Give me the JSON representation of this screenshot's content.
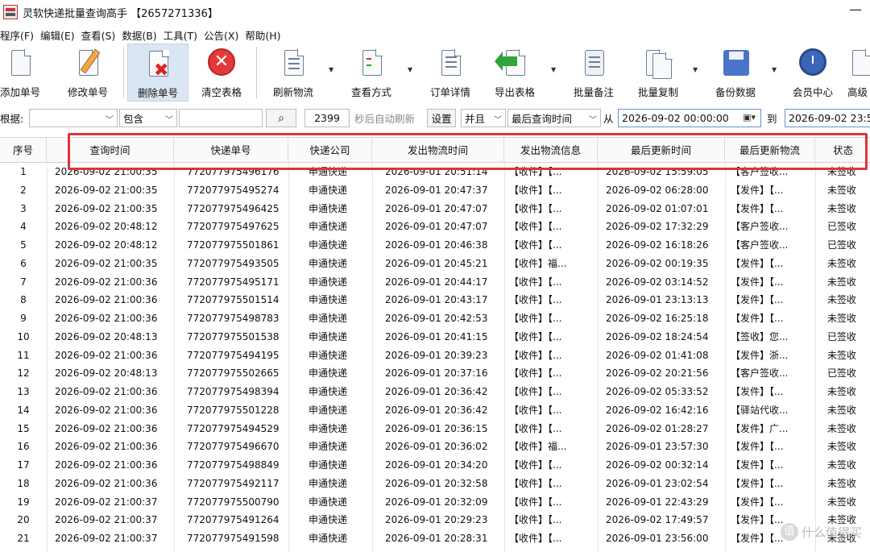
{
  "window": {
    "title": "灵软快递批量查询高手 【2657271336】",
    "minimize": "—"
  },
  "menu": [
    "程序(F)",
    "编辑(E)",
    "查看(S)",
    "数据(B)",
    "工具(T)",
    "公告(X)",
    "帮助(H)"
  ],
  "toolbar": [
    {
      "label": "添加单号",
      "icon": "add-doc-icon"
    },
    {
      "label": "修改单号",
      "icon": "edit-pencil-icon"
    },
    {
      "label": "删除单号",
      "icon": "delete-x-icon"
    },
    {
      "label": "清空表格",
      "icon": "clear-stop-icon"
    },
    {
      "label": "刷新物流",
      "icon": "refresh-doc-icon"
    },
    {
      "label": "查看方式",
      "icon": "view-list-icon"
    },
    {
      "label": "订单详情",
      "icon": "order-detail-icon"
    },
    {
      "label": "导出表格",
      "icon": "export-arrow-icon"
    },
    {
      "label": "批量备注",
      "icon": "batch-note-icon"
    },
    {
      "label": "批量复制",
      "icon": "batch-copy-icon"
    },
    {
      "label": "备份数据",
      "icon": "floppy-icon"
    },
    {
      "label": "会员中心",
      "icon": "clock-member-icon"
    },
    {
      "label": "高级",
      "icon": "advanced-icon"
    }
  ],
  "filter": {
    "by_label": "根据:",
    "field_value": "",
    "match_value": "包含",
    "keyword_value": "",
    "search_glyph": "⌕",
    "refresh_seconds": "2399",
    "refresh_suffix": "秒后自动刷新",
    "settings_label": "设置",
    "logic_value": "并且",
    "time_field_value": "最后查询时间",
    "from_label": "从",
    "from_value": "2026-09-02 00:00:00",
    "to_label": "到",
    "to_value": "2026-09-02 23:5"
  },
  "table": {
    "columns": [
      "序号",
      "查询时间",
      "快递单号",
      "快递公司",
      "发出物流时间",
      "发出物流信息",
      "最后更新时间",
      "最后更新物流",
      "状态"
    ],
    "rows": [
      [
        "1",
        "2026-09-02 21:00:35",
        "772077975496176",
        "申通快递",
        "2026-09-01 20:51:14",
        "【收件】【...",
        "2026-09-02 15:59:05",
        "【客户签收...",
        "未签收"
      ],
      [
        "2",
        "2026-09-02 21:00:35",
        "772077975495274",
        "申通快递",
        "2026-09-01 20:47:37",
        "【收件】【...",
        "2026-09-02 06:28:00",
        "【发件】【...",
        "未签收"
      ],
      [
        "3",
        "2026-09-02 21:00:35",
        "772077975496425",
        "申通快递",
        "2026-09-01 20:47:07",
        "【收件】【...",
        "2026-09-02 01:07:01",
        "【发件】【...",
        "未签收"
      ],
      [
        "4",
        "2026-09-02 20:48:12",
        "772077975497625",
        "申通快递",
        "2026-09-01 20:47:07",
        "【收件】【...",
        "2026-09-02 17:32:29",
        "【客户签收...",
        "已签收"
      ],
      [
        "5",
        "2026-09-02 20:48:12",
        "772077975501861",
        "申通快递",
        "2026-09-01 20:46:38",
        "【收件】【...",
        "2026-09-02 16:18:26",
        "【客户签收...",
        "已签收"
      ],
      [
        "6",
        "2026-09-02 21:00:35",
        "772077975493505",
        "申通快递",
        "2026-09-01 20:45:21",
        "【收件】福...",
        "2026-09-02 00:19:35",
        "【发件】【...",
        "未签收"
      ],
      [
        "7",
        "2026-09-02 21:00:36",
        "772077975495171",
        "申通快递",
        "2026-09-01 20:44:17",
        "【收件】【...",
        "2026-09-02 03:14:52",
        "【发件】【...",
        "未签收"
      ],
      [
        "8",
        "2026-09-02 21:00:36",
        "772077975501514",
        "申通快递",
        "2026-09-01 20:43:17",
        "【收件】【...",
        "2026-09-01 23:13:13",
        "【发件】【...",
        "未签收"
      ],
      [
        "9",
        "2026-09-02 21:00:36",
        "772077975498783",
        "申通快递",
        "2026-09-01 20:42:53",
        "【收件】【...",
        "2026-09-02 16:25:18",
        "【发件】【...",
        "未签收"
      ],
      [
        "10",
        "2026-09-02 20:48:13",
        "772077975501538",
        "申通快递",
        "2026-09-01 20:41:15",
        "【收件】【...",
        "2026-09-02 18:24:54",
        "【签收】您...",
        "已签收"
      ],
      [
        "11",
        "2026-09-02 21:00:36",
        "772077975494195",
        "申通快递",
        "2026-09-01 20:39:23",
        "【收件】【...",
        "2026-09-02 01:41:08",
        "【发件】浙...",
        "未签收"
      ],
      [
        "12",
        "2026-09-02 20:48:13",
        "772077975502665",
        "申通快递",
        "2026-09-01 20:37:16",
        "【收件】【...",
        "2026-09-02 20:21:56",
        "【客户签收...",
        "已签收"
      ],
      [
        "13",
        "2026-09-02 21:00:36",
        "772077975498394",
        "申通快递",
        "2026-09-01 20:36:42",
        "【收件】【...",
        "2026-09-02 05:33:52",
        "【发件】【...",
        "未签收"
      ],
      [
        "14",
        "2026-09-02 21:00:36",
        "772077975501228",
        "申通快递",
        "2026-09-01 20:36:42",
        "【收件】【...",
        "2026-09-02 16:42:16",
        "【驿站代收...",
        "未签收"
      ],
      [
        "15",
        "2026-09-02 21:00:36",
        "772077975494529",
        "申通快递",
        "2026-09-01 20:36:15",
        "【收件】【...",
        "2026-09-02 01:28:27",
        "【发件】广...",
        "未签收"
      ],
      [
        "16",
        "2026-09-02 21:00:36",
        "772077975496670",
        "申通快递",
        "2026-09-01 20:36:02",
        "【收件】福...",
        "2026-09-01 23:57:30",
        "【发件】【...",
        "未签收"
      ],
      [
        "17",
        "2026-09-02 21:00:36",
        "772077975498849",
        "申通快递",
        "2026-09-01 20:34:20",
        "【收件】【...",
        "2026-09-02 00:32:14",
        "【发件】【...",
        "未签收"
      ],
      [
        "18",
        "2026-09-02 21:00:36",
        "772077975492117",
        "申通快递",
        "2026-09-01 20:32:58",
        "【收件】【...",
        "2026-09-01 23:02:54",
        "【发件】【...",
        "未签收"
      ],
      [
        "19",
        "2026-09-02 21:00:37",
        "772077975500790",
        "申通快递",
        "2026-09-01 20:32:09",
        "【收件】【...",
        "2026-09-01 22:43:29",
        "【发件】【...",
        "未签收"
      ],
      [
        "20",
        "2026-09-02 21:00:37",
        "772077975491264",
        "申通快递",
        "2026-09-01 20:29:23",
        "【收件】【...",
        "2026-09-02 17:49:57",
        "【发件】【...",
        "未签收"
      ],
      [
        "21",
        "2026-09-02 21:00:37",
        "772077975491598",
        "申通快递",
        "2026-09-01 20:28:31",
        "【收件】【...",
        "2026-09-01 23:56:00",
        "【发件】【...",
        "未签收"
      ]
    ]
  },
  "watermark": {
    "badge": "值",
    "text": "什么值得买"
  },
  "colors": {
    "highlight": "#e0343a",
    "active_button_bg": "#dbe6f4"
  }
}
